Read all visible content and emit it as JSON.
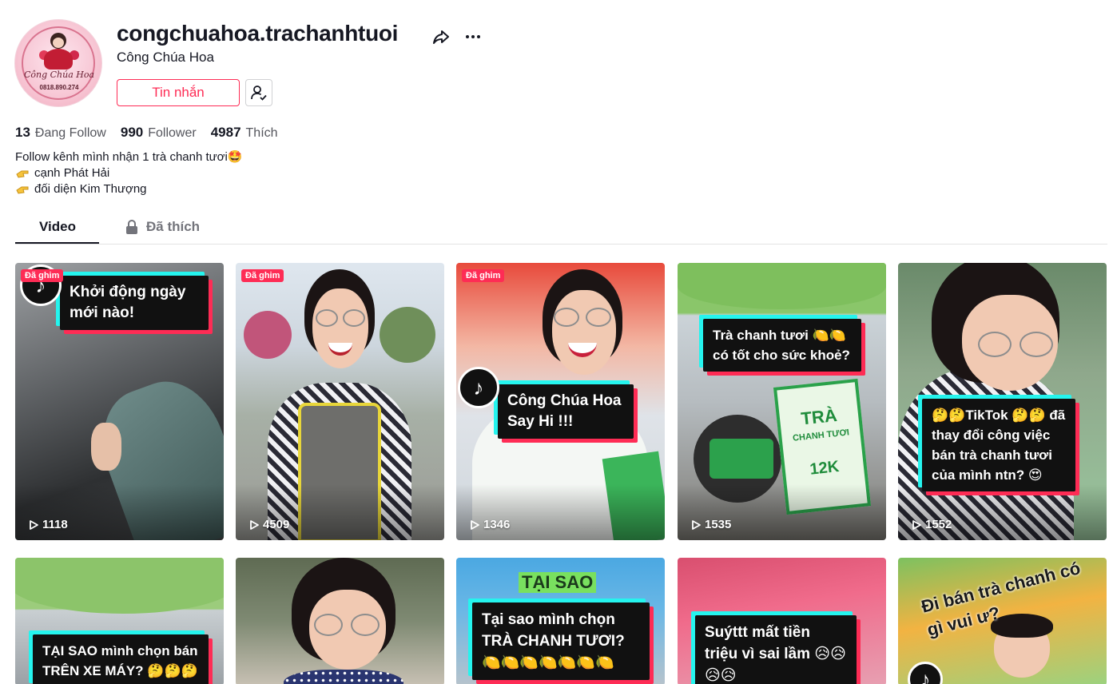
{
  "profile": {
    "username": "congchuahoa.trachanhtuoi",
    "nickname": "Công Chúa Hoa",
    "avatar_text": "Công Chúa Hoa",
    "avatar_phone": "0818.890.274",
    "message_button": "Tin nhắn",
    "share_icon": "share-icon",
    "more_icon": "more-options-icon",
    "follow_icon": "user-check-icon"
  },
  "stats": {
    "following_count": "13",
    "following_label": "Đang Follow",
    "followers_count": "990",
    "followers_label": "Follower",
    "likes_count": "4987",
    "likes_label": "Thích"
  },
  "bio": {
    "line1": "Follow kênh mình nhận 1 trà chanh tươi🤩",
    "line2": "cạnh Phát Hải",
    "line3": "đối diện Kim Thượng"
  },
  "tabs": {
    "video": "Video",
    "liked": "Đã thích"
  },
  "videos": [
    {
      "pinned": "Đã ghim",
      "caption": "Khởi động ngày mới nào!",
      "views": "1118"
    },
    {
      "pinned": "Đã ghim",
      "caption": "",
      "views": "4509"
    },
    {
      "pinned": "Đã ghim",
      "caption": "Công Chúa Hoa Say Hi !!!",
      "views": "1346"
    },
    {
      "pinned": "",
      "caption": "Trà chanh tươi 🍋🍋 có tốt cho sức khoẻ?",
      "views": "1535",
      "sign_title": "TRÀ",
      "sign_sub": "CHANH TƯƠI",
      "sign_price": "12K"
    },
    {
      "pinned": "",
      "caption": "🤔🤔TikTok 🤔🤔 đã thay đổi công việc bán trà chanh tươi của mình ntn? 😍",
      "views": "1552"
    },
    {
      "pinned": "",
      "caption": "TẠI SAO mình chọn bán TRÊN XE MÁY? 🤔🤔🤔",
      "views": ""
    },
    {
      "pinned": "",
      "caption": "",
      "views": ""
    },
    {
      "pinned": "",
      "caption": "Tại sao mình chọn TRÀ CHANH TƯƠI? 🍋🍋🍋🍋🍋🍋🍋",
      "views": "",
      "top_text": "TẠI SAO"
    },
    {
      "pinned": "",
      "caption": "Suýttt mất tiền triệu vì sai lầm 😥😥😥😥",
      "views": ""
    },
    {
      "pinned": "",
      "caption": "",
      "views": "",
      "top_text": "Đi bán trà chanh có gì vui ư?"
    }
  ],
  "colors": {
    "accent": "#fe2c55",
    "cyan": "#25f4ee",
    "text": "#161823",
    "muted": "#54555c"
  }
}
